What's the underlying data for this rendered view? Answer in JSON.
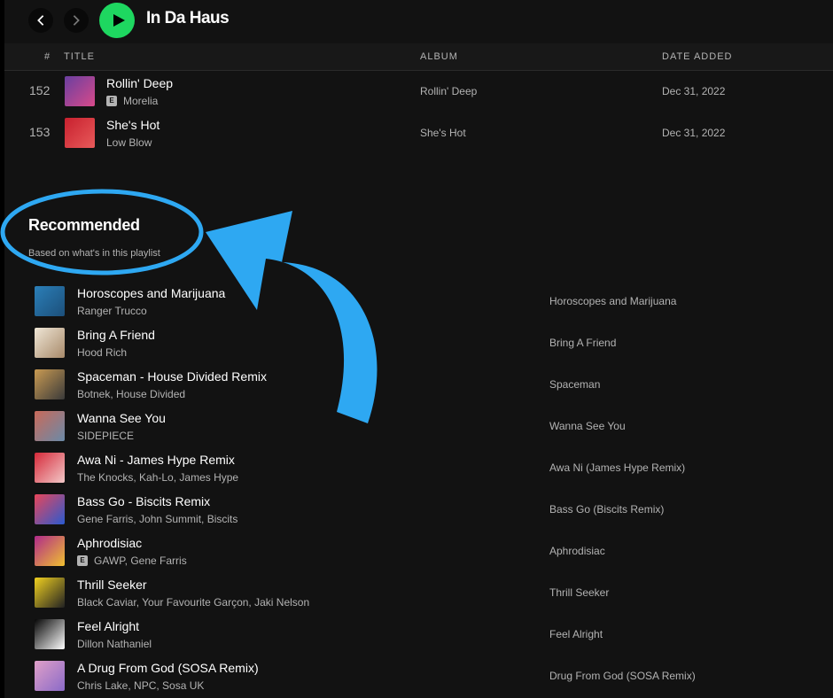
{
  "playlist": {
    "title": "In Da Haus"
  },
  "icons": {
    "back": "chevron-left-icon",
    "forward": "chevron-right-icon",
    "play": "play-icon",
    "explicit": "explicit-badge"
  },
  "colors": {
    "accent": "#1ed760",
    "annotation": "#2ea8f2",
    "background": "#121212",
    "muted_text": "#b3b3b3"
  },
  "table_header": {
    "num": "#",
    "title": "TITLE",
    "album": "ALBUM",
    "date": "DATE ADDED"
  },
  "tracks": [
    {
      "num": "152",
      "title": "Rollin' Deep",
      "explicit": true,
      "explicit_label": "E",
      "artists": "Morelia",
      "album": "Rollin' Deep",
      "date": "Dec 31, 2022",
      "cover_colors": [
        "#6a3fa0",
        "#d84a8a"
      ]
    },
    {
      "num": "153",
      "title": "She's Hot",
      "explicit": false,
      "artists": "Low Blow",
      "album": "She's Hot",
      "date": "Dec 31, 2022",
      "cover_colors": [
        "#c8202e",
        "#e85a5a"
      ]
    }
  ],
  "recommended": {
    "title": "Recommended",
    "subtitle": "Based on what's in this playlist",
    "items": [
      {
        "title": "Horoscopes and Marijuana",
        "explicit": false,
        "artists": "Ranger Trucco",
        "album": "Horoscopes and Marijuana",
        "cover_colors": [
          "#2b7fb8",
          "#1c4f7a"
        ]
      },
      {
        "title": "Bring A Friend",
        "explicit": false,
        "artists": "Hood Rich",
        "album": "Bring A Friend",
        "cover_colors": [
          "#efe6d6",
          "#a88a6a"
        ]
      },
      {
        "title": "Spaceman - House Divided Remix",
        "explicit": false,
        "artists": "Botnek, House Divided",
        "album": "Spaceman",
        "cover_colors": [
          "#c99a52",
          "#3a3a3a"
        ]
      },
      {
        "title": "Wanna See You",
        "explicit": false,
        "artists": "SIDEPIECE",
        "album": "Wanna See You",
        "cover_colors": [
          "#c96a5a",
          "#6a8aa8"
        ]
      },
      {
        "title": "Awa Ni - James Hype Remix",
        "explicit": false,
        "artists": "The Knocks, Kah-Lo, James Hype",
        "album": "Awa Ni (James Hype Remix)",
        "cover_colors": [
          "#d62a3a",
          "#f2c8c8"
        ]
      },
      {
        "title": "Bass Go - Biscits Remix",
        "explicit": false,
        "artists": "Gene Farris, John Summit, Biscits",
        "album": "Bass Go (Biscits Remix)",
        "cover_colors": [
          "#e8465a",
          "#2a5ad0"
        ]
      },
      {
        "title": "Aphrodisiac",
        "explicit": true,
        "explicit_label": "E",
        "artists": "GAWP, Gene Farris",
        "album": "Aphrodisiac",
        "cover_colors": [
          "#b02a8a",
          "#f0c030"
        ]
      },
      {
        "title": "Thrill Seeker",
        "explicit": false,
        "artists": "Black Caviar, Your Favourite Garçon, Jaki Nelson",
        "album": "Thrill Seeker",
        "cover_colors": [
          "#f0d020",
          "#222222"
        ]
      },
      {
        "title": "Feel Alright",
        "explicit": false,
        "artists": "Dillon Nathaniel",
        "album": "Feel Alright",
        "cover_colors": [
          "#050505",
          "#ffffff"
        ]
      },
      {
        "title": "A Drug From God (SOSA Remix)",
        "explicit": false,
        "artists": "Chris Lake, NPC, Sosa UK",
        "album": "Drug From God (SOSA Remix)",
        "cover_colors": [
          "#e0a0c8",
          "#8a6ac8"
        ]
      }
    ]
  }
}
